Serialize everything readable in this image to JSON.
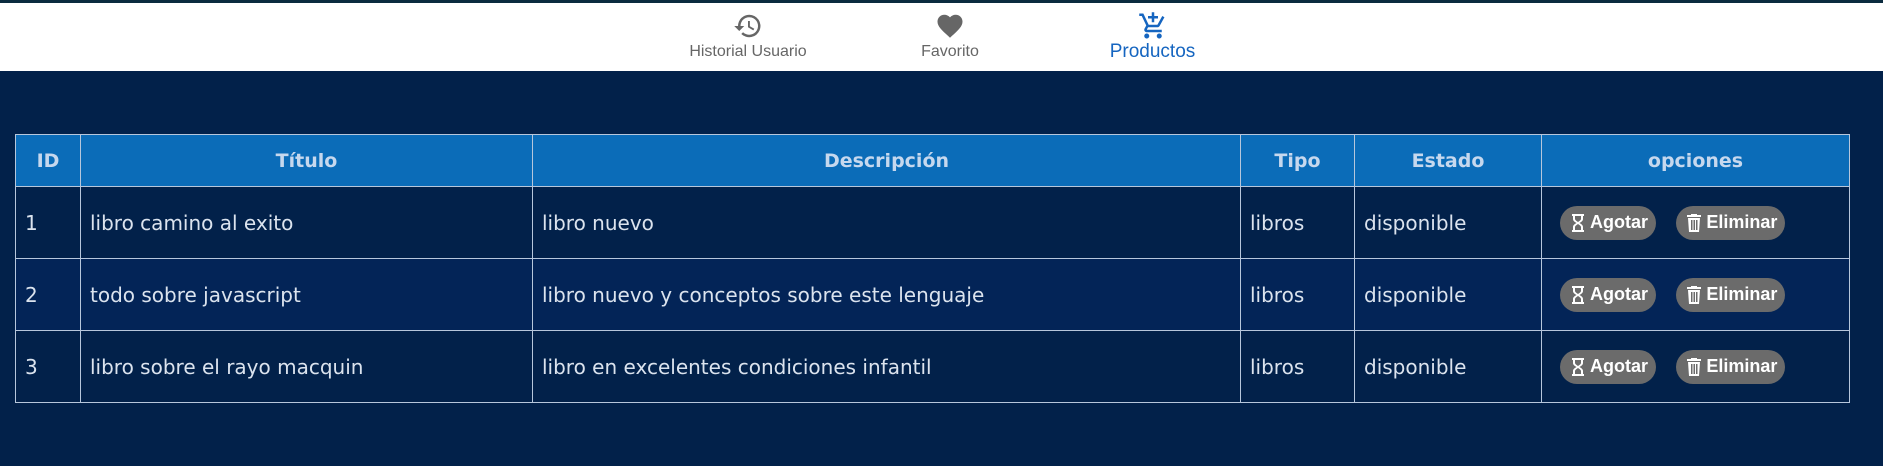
{
  "nav": {
    "items": [
      {
        "label": "Historial Usuario",
        "icon": "history-icon"
      },
      {
        "label": "Favorito",
        "icon": "heart-icon"
      },
      {
        "label": "Productos",
        "icon": "cart-icon",
        "active": true
      }
    ]
  },
  "table": {
    "headers": [
      "ID",
      "Título",
      "Descripción",
      "Tipo",
      "Estado",
      "opciones"
    ],
    "rows": [
      {
        "id": "1",
        "titulo": "libro camino al exito",
        "descripcion": "libro nuevo",
        "tipo": "libros",
        "estado": "disponible"
      },
      {
        "id": "2",
        "titulo": "todo sobre javascript",
        "descripcion": "libro nuevo y conceptos sobre este lenguaje",
        "tipo": "libros",
        "estado": "disponible"
      },
      {
        "id": "3",
        "titulo": "libro sobre el rayo macquin",
        "descripcion": "libro en excelentes condiciones infantil",
        "tipo": "libros",
        "estado": "disponible"
      }
    ],
    "actions": {
      "agotar": "Agotar",
      "eliminar": "Eliminar"
    }
  },
  "colors": {
    "background": "#02214a",
    "header": "#0b6cb8",
    "active_nav": "#1565c0",
    "button": "#6b6b6b"
  }
}
